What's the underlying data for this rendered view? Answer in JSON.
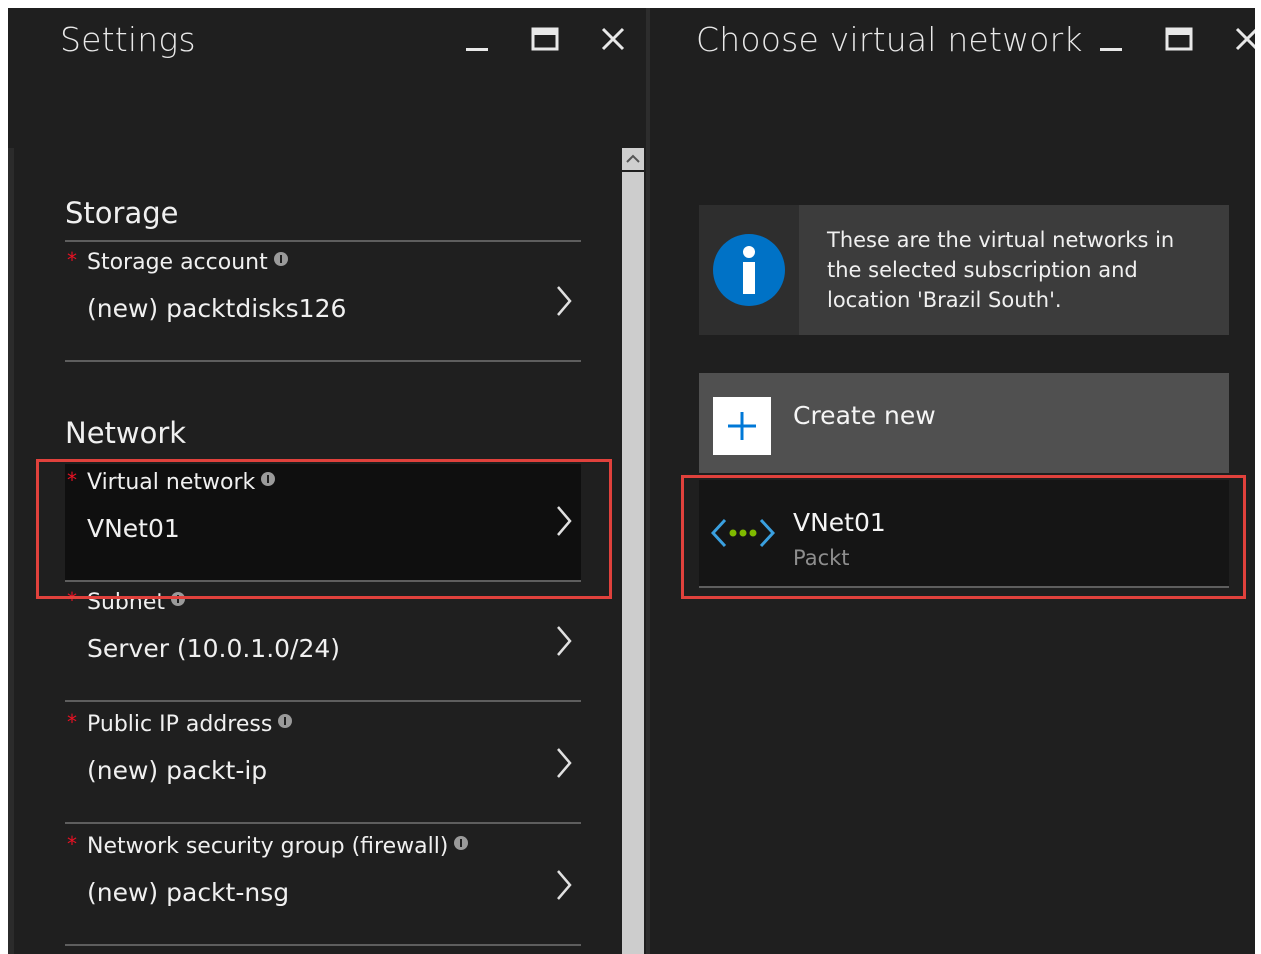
{
  "settings_blade": {
    "title": "Settings",
    "sections": {
      "storage": {
        "heading": "Storage",
        "items": [
          {
            "label": "Storage account",
            "value": "(new) packtdisks126",
            "required": true
          }
        ]
      },
      "network": {
        "heading": "Network",
        "items": [
          {
            "label": "Virtual network",
            "value": "VNet01",
            "required": true,
            "selected": true
          },
          {
            "label": "Subnet",
            "value": "Server (10.0.1.0/24)",
            "required": true
          },
          {
            "label": "Public IP address",
            "value": "(new) packt-ip",
            "required": true
          },
          {
            "label": "Network security group (firewall)",
            "value": "(new) packt-nsg",
            "required": true
          }
        ]
      }
    },
    "required_marker": "*"
  },
  "vnet_blade": {
    "title": "Choose virtual network",
    "info_text": "These are the virtual networks in the selected subscription and location 'Brazil South'.",
    "create_new_label": "Create new",
    "networks": [
      {
        "name": "VNet01",
        "resource_group": "Packt",
        "selected": true
      }
    ]
  },
  "icons": {
    "minimize": "minimize-icon",
    "maximize": "maximize-icon",
    "close": "close-icon",
    "info": "info-icon",
    "chevron": "chevron-right-icon",
    "plus": "plus-icon",
    "vnet": "virtual-network-icon"
  },
  "colors": {
    "blade_background": "#1f1f1f",
    "highlight": "#e0413c",
    "required": "#e81123",
    "info_blue": "#0072c6",
    "accent_blue": "#0078d7",
    "vnet_green": "#7fba00"
  }
}
